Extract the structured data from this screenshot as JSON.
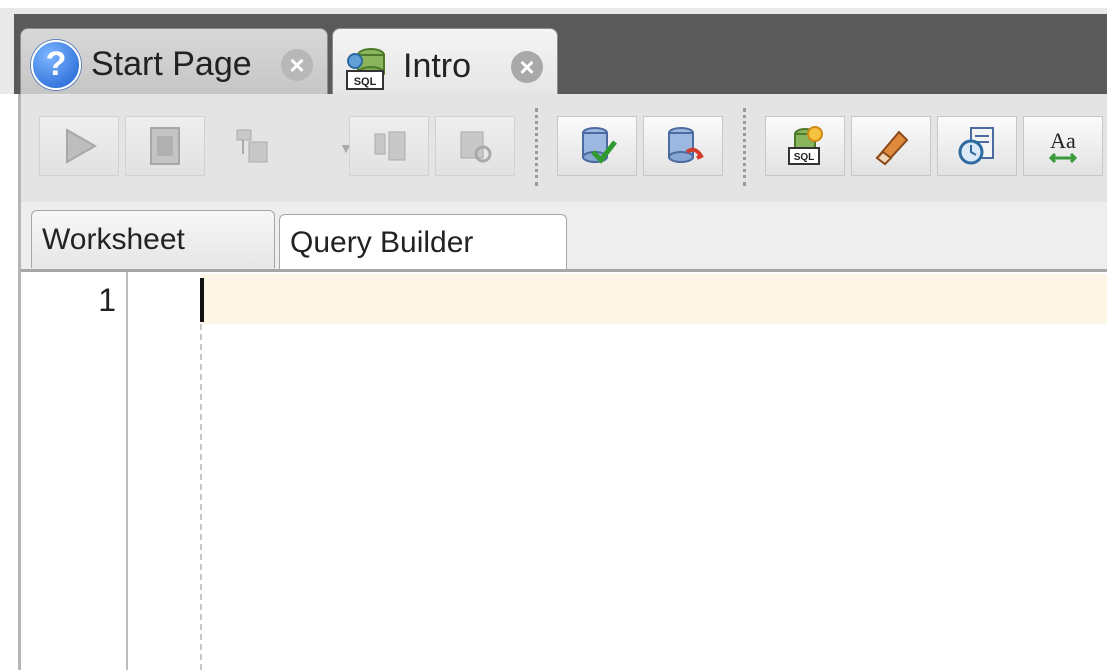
{
  "doc_tabs": [
    {
      "label": "Start Page",
      "icon": "help-icon",
      "active": false
    },
    {
      "label": "Intro",
      "icon": "sql-worksheet-icon",
      "active": true
    }
  ],
  "toolbar": {
    "buttons": [
      {
        "name": "run-statement-button",
        "icon": "play-icon",
        "enabled": false
      },
      {
        "name": "run-script-button",
        "icon": "script-icon",
        "enabled": false
      },
      {
        "name": "explain-plan-button",
        "icon": "explain-plan-icon",
        "enabled": false
      },
      {
        "name": "autotrace-button",
        "icon": "autotrace-icon",
        "enabled": false
      },
      {
        "name": "sql-tuning-button",
        "icon": "tuning-icon",
        "enabled": false
      },
      {
        "name": "commit-button",
        "icon": "commit-icon",
        "enabled": true
      },
      {
        "name": "rollback-button",
        "icon": "rollback-icon",
        "enabled": true
      },
      {
        "name": "unshared-worksheet-button",
        "icon": "sql-new-icon",
        "enabled": true
      },
      {
        "name": "clear-button",
        "icon": "eraser-icon",
        "enabled": true
      },
      {
        "name": "sql-history-button",
        "icon": "history-icon",
        "enabled": true
      },
      {
        "name": "to-upper-lower-button",
        "icon": "case-icon",
        "enabled": true,
        "text": "Aa"
      }
    ]
  },
  "ws_tabs": [
    {
      "label": "Worksheet",
      "active": true
    },
    {
      "label": "Query Builder",
      "active": false
    }
  ],
  "editor": {
    "line_numbers": [
      "1"
    ],
    "content": ""
  },
  "colors": {
    "current_line": "#fdf5e6",
    "tab_strip": "#5a5a5a",
    "toolbar": "#e4e4e4"
  }
}
